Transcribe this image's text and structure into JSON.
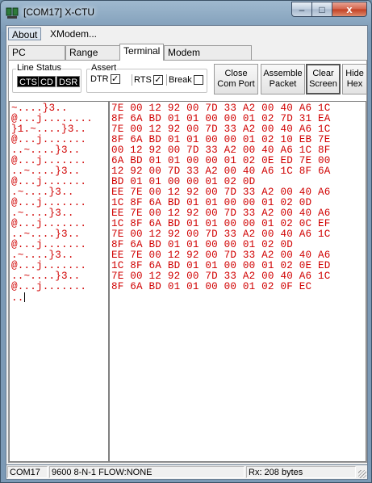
{
  "window": {
    "title": "[COM17] X-CTU",
    "controls": {
      "minimize": "–",
      "maximize": "□",
      "close": "x"
    }
  },
  "menu": {
    "items": [
      "About",
      "XModem..."
    ]
  },
  "tabs": [
    "PC Settings",
    "Range Test",
    "Terminal",
    "Modem Configuration"
  ],
  "active_tab": "Terminal",
  "line_status": {
    "label": "Line Status",
    "indicators": [
      "CTS",
      "CD",
      "DSR"
    ]
  },
  "assert": {
    "label": "Assert",
    "dtr": {
      "label": "DTR",
      "checked": true
    },
    "rts": {
      "label": "RTS",
      "checked": true
    },
    "break": {
      "label": "Break",
      "checked": false
    }
  },
  "buttons": {
    "close_com": [
      "Close",
      "Com Port"
    ],
    "assemble": [
      "Assemble",
      "Packet"
    ],
    "clear": [
      "Clear",
      "Screen"
    ],
    "hide_hex": [
      "Hide",
      "Hex"
    ]
  },
  "terminal": {
    "ascii_lines": [
      "~....}3..",
      "@...j........",
      "}1.~....}3..",
      "@...j.......",
      "..~....}3..",
      "@...j.......",
      "..~....}3..",
      "@...j.......",
      ".~....}3..",
      "@...j.......",
      ".~....}3..",
      "@...j.......",
      "..~....}3..",
      "@...j.......",
      ".~....}3..",
      "@...j.......",
      "..~....}3..",
      "@...j.......",
      ".."
    ],
    "hex_lines": [
      "7E 00 12 92 00 7D 33 A2 00 40 A6 1C",
      "8F 6A BD 01 01 00 00 01 02 7D 31 EA",
      "7E 00 12 92 00 7D 33 A2 00 40 A6 1C",
      "8F 6A BD 01 01 00 00 01 02 10 EB 7E",
      "00 12 92 00 7D 33 A2 00 40 A6 1C 8F",
      "6A BD 01 01 00 00 01 02 0E ED 7E 00",
      "12 92 00 7D 33 A2 00 40 A6 1C 8F 6A",
      "BD 01 01 00 00 01 02 0D",
      "EE 7E 00 12 92 00 7D 33 A2 00 40 A6",
      "1C 8F 6A BD 01 01 00 00 01 02 0D",
      "EE 7E 00 12 92 00 7D 33 A2 00 40 A6",
      "1C 8F 6A BD 01 01 00 00 01 02 0C EF",
      "7E 00 12 92 00 7D 33 A2 00 40 A6 1C",
      "8F 6A BD 01 01 00 00 01 02 0D",
      "EE 7E 00 12 92 00 7D 33 A2 00 40 A6",
      "1C 8F 6A BD 01 01 00 00 01 02 0E ED",
      "7E 00 12 92 00 7D 33 A2 00 40 A6 1C",
      "8F 6A BD 01 01 00 00 01 02 0F EC"
    ],
    "text_color": "#d00000"
  },
  "status": {
    "port": "COM17",
    "config": "9600 8-N-1  FLOW:NONE",
    "rx": "Rx: 208 bytes"
  }
}
